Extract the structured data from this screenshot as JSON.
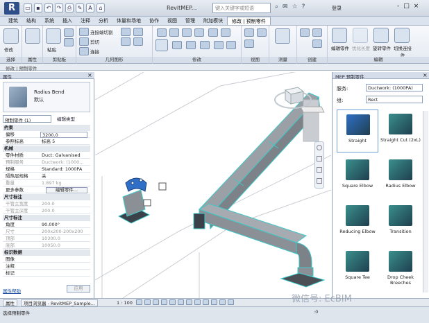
{
  "titlebar": {
    "app_letter": "R",
    "document_title": "RevitMEP...",
    "search_placeholder": "键入关键字或短语",
    "login": "登录",
    "controls": [
      "-",
      "□",
      "×"
    ]
  },
  "menu": {
    "tabs": [
      "建筑",
      "结构",
      "系统",
      "插入",
      "注释",
      "分析",
      "体量和场地",
      "协作",
      "视图",
      "管理",
      "附加模块",
      "修改 | 预制零件"
    ],
    "active_index": 11
  },
  "ribbon": {
    "groups": [
      {
        "label": "选择",
        "button": "修改"
      },
      {
        "label": "属性"
      },
      {
        "label": "剪贴板",
        "button": "粘贴"
      },
      {
        "label": "几何图形",
        "items": [
          "连接端切割",
          "剪切",
          "连接"
        ]
      },
      {
        "label": "修改"
      },
      {
        "label": "视图"
      },
      {
        "label": "测量"
      },
      {
        "label": "创建"
      },
      {
        "label": "编辑",
        "buttons": [
          "编辑零件",
          "优化长度",
          "旋转零件",
          "切换连接件"
        ]
      }
    ]
  },
  "options_bar": {
    "label": "修改 | 预制零件"
  },
  "properties": {
    "title": "属性",
    "family_name": "Radius Bend",
    "family_type": "默认",
    "type_select": "预制零件 (1)",
    "edit_type": "编辑类型",
    "rows": [
      {
        "kind": "sec",
        "k": "约束"
      },
      {
        "kind": "input",
        "k": "偏移",
        "v": "3200.0"
      },
      {
        "kind": "row",
        "k": "参照标高",
        "v": "标高 5"
      },
      {
        "kind": "sec",
        "k": "机械"
      },
      {
        "kind": "row",
        "k": "零件材质",
        "v": "Duct: Galvanised"
      },
      {
        "kind": "dis",
        "k": "预制服务",
        "v": "Ductwork: (1000..."
      },
      {
        "kind": "row",
        "k": "规格",
        "v": "Standard: 1000PA"
      },
      {
        "kind": "row",
        "k": "隔热层规格",
        "v": "关"
      },
      {
        "kind": "dis",
        "k": "重量",
        "v": "1.897 kg"
      },
      {
        "kind": "btn",
        "k": "更多参数",
        "v": "编辑零件..."
      },
      {
        "kind": "sec",
        "k": "尺寸标注"
      },
      {
        "kind": "dis",
        "k": "干管主宽度",
        "v": "200.0"
      },
      {
        "kind": "dis",
        "k": "干管主深度",
        "v": "200.0"
      },
      {
        "kind": "sec",
        "k": "尺寸标注"
      },
      {
        "kind": "row",
        "k": "角度",
        "v": "90.000°"
      },
      {
        "kind": "dis",
        "k": "尺寸",
        "v": "200x200-200x200"
      },
      {
        "kind": "dis",
        "k": "顶部",
        "v": "10300.0"
      },
      {
        "kind": "dis",
        "k": "底部",
        "v": "10050.0"
      },
      {
        "kind": "sec",
        "k": "标识数据"
      },
      {
        "kind": "row",
        "k": "图像",
        "v": ""
      },
      {
        "kind": "row",
        "k": "注释",
        "v": ""
      },
      {
        "kind": "row",
        "k": "标记",
        "v": ""
      }
    ],
    "help": "属性帮助",
    "apply": "应用"
  },
  "browser": {
    "title": "MEP 预制零件",
    "service_label": "服务:",
    "service_value": "Ductwork: (1000PA)",
    "group_label": "组:",
    "group_value": "Rect",
    "parts": [
      {
        "label": "Straight",
        "selected": true,
        "color": "#2f6fc7"
      },
      {
        "label": "Straight Cut (2xL)",
        "selected": false,
        "color": "#3a8f8c"
      },
      {
        "label": "Square Elbow",
        "selected": false,
        "color": "#3a8f8c"
      },
      {
        "label": "Radius Elbow",
        "selected": false,
        "color": "#3a8f8c"
      },
      {
        "label": "Reducing Elbow",
        "selected": false,
        "color": "#3a8f8c"
      },
      {
        "label": "Transition",
        "selected": false,
        "color": "#3a8f8c"
      },
      {
        "label": "Square Tee",
        "selected": false,
        "color": "#3a8f8c"
      },
      {
        "label": "Drop Cheek Breeches",
        "selected": false,
        "color": "#3a8f8c"
      }
    ]
  },
  "bottom": {
    "tabs": [
      "属性",
      "项目浏览器 - RevitMEP_Sample..."
    ],
    "scale": "1 : 100",
    "status_text": "选择预制零件",
    "model": ":0"
  },
  "watermark": "微信号: EcBIM",
  "colors": {
    "duct": "#8e9499",
    "duct_edge": "#3ec9c9",
    "selection": "#2f6fc7"
  }
}
